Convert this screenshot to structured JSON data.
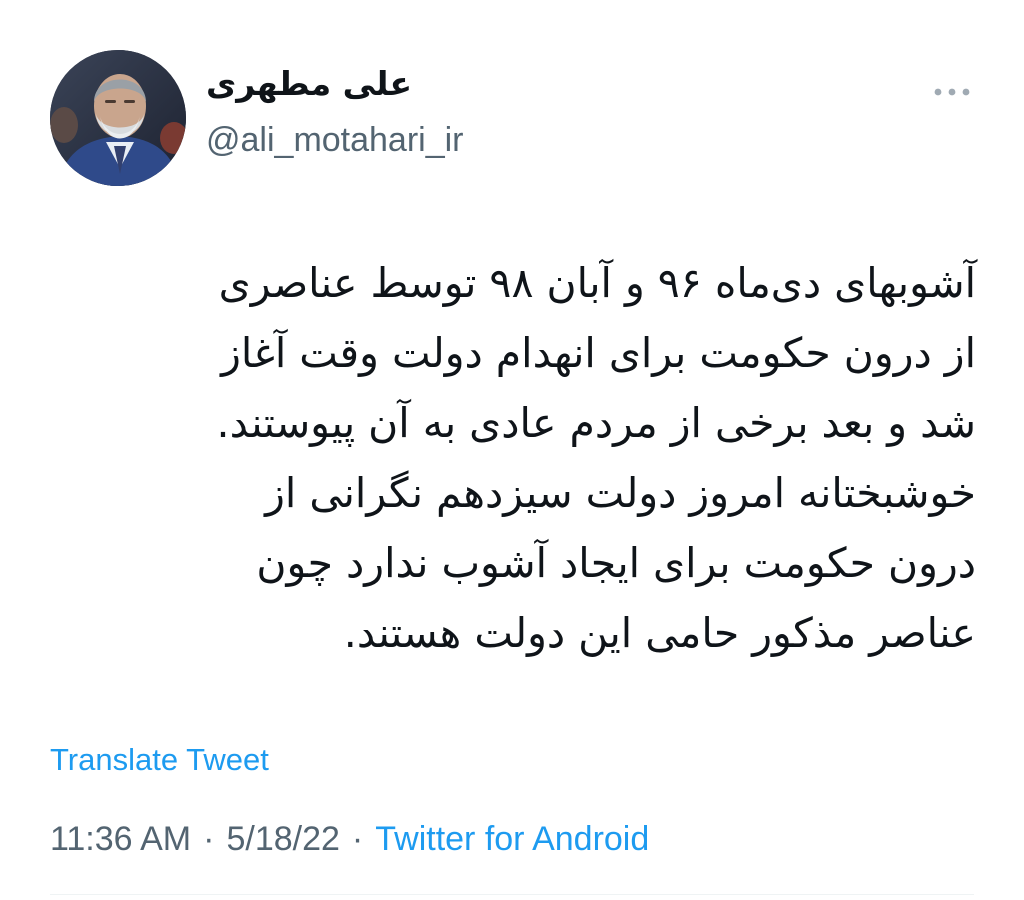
{
  "author": {
    "name": "علی مطهری",
    "handle": "@ali_motahari_ir",
    "avatar_icon": "profile-photo-icon"
  },
  "more_icon": "more-horizontal-icon",
  "tweet": {
    "lines": [
      "آشوبهای دی‌ماه ۹۶ و آبان ۹۸ توسط عناصری",
      "از درون حکومت برای انهدام دولت وقت آغاز",
      "شد و بعد برخی از مردم عادی به آن پیوستند.",
      "خوشبختانه امروز دولت سیزدهم نگرانی از",
      "درون حکومت برای ایجاد آشوب ندارد چون",
      "عناصر مذکور حامی این دولت هستند."
    ]
  },
  "translate_label": "Translate Tweet",
  "meta": {
    "time": "11:36 AM",
    "date": "5/18/22",
    "separator": "·",
    "source": "Twitter for Android"
  },
  "colors": {
    "link": "#1d9bf0",
    "secondary_text": "#536471",
    "primary_text": "#0f1419"
  }
}
